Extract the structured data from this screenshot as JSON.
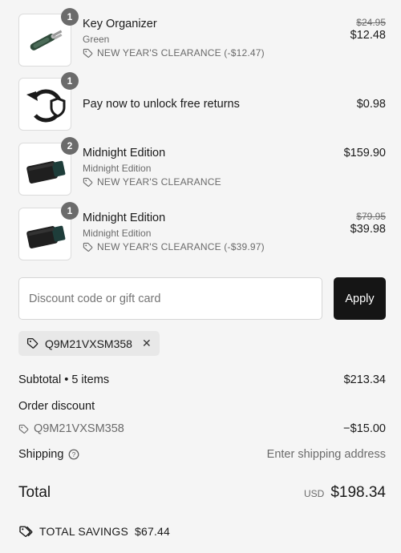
{
  "items": [
    {
      "qty": "1",
      "name": "Key Organizer",
      "variant": "Green",
      "promo": "NEW YEAR'S CLEARANCE (-$12.47)",
      "compare_price": "$24.95",
      "price": "$12.48",
      "image_icon": "key-organizer-image"
    },
    {
      "qty": "1",
      "name": "Pay now to unlock free returns",
      "variant": "",
      "promo": "",
      "compare_price": "",
      "price": "$0.98",
      "image_icon": "returns-shield-icon"
    },
    {
      "qty": "2",
      "name": "Midnight Edition",
      "variant": "Midnight Edition",
      "promo": "NEW YEAR'S CLEARANCE",
      "compare_price": "",
      "price": "$159.90",
      "image_icon": "wallet-image"
    },
    {
      "qty": "1",
      "name": "Midnight Edition",
      "variant": "Midnight Edition",
      "promo": "NEW YEAR'S CLEARANCE (-$39.97)",
      "compare_price": "$79.95",
      "price": "$39.98",
      "image_icon": "wallet-image"
    }
  ],
  "discount": {
    "placeholder": "Discount code or gift card",
    "apply_label": "Apply"
  },
  "applied_code": "Q9M21VXSM358",
  "summary": {
    "subtotal_label": "Subtotal • 5 items",
    "subtotal_value": "$213.34",
    "order_discount_label": "Order discount",
    "discount_code": "Q9M21VXSM358",
    "discount_value": "−$15.00",
    "shipping_label": "Shipping",
    "shipping_value": "Enter shipping address",
    "total_label": "Total",
    "currency": "USD",
    "total_value": "$198.34",
    "savings_label": "TOTAL SAVINGS",
    "savings_value": "$67.44"
  },
  "colors": {
    "accent_button": "#151515",
    "muted_text": "#6b6b6b",
    "badge": "#6b6b6b"
  }
}
